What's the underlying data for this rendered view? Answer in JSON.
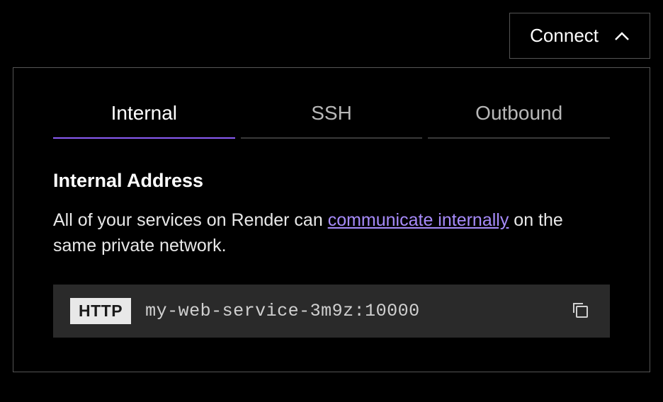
{
  "header": {
    "connect_label": "Connect"
  },
  "tabs": [
    {
      "label": "Internal",
      "active": true
    },
    {
      "label": "SSH",
      "active": false
    },
    {
      "label": "Outbound",
      "active": false
    }
  ],
  "section": {
    "title": "Internal Address",
    "description_prefix": "All of your services on Render can ",
    "description_link": "communicate internally",
    "description_suffix": " on the same private network."
  },
  "address": {
    "protocol": "HTTP",
    "value": "my-web-service-3m9z:10000"
  },
  "colors": {
    "accent": "#8b5cf6",
    "link": "#a78bfa"
  }
}
